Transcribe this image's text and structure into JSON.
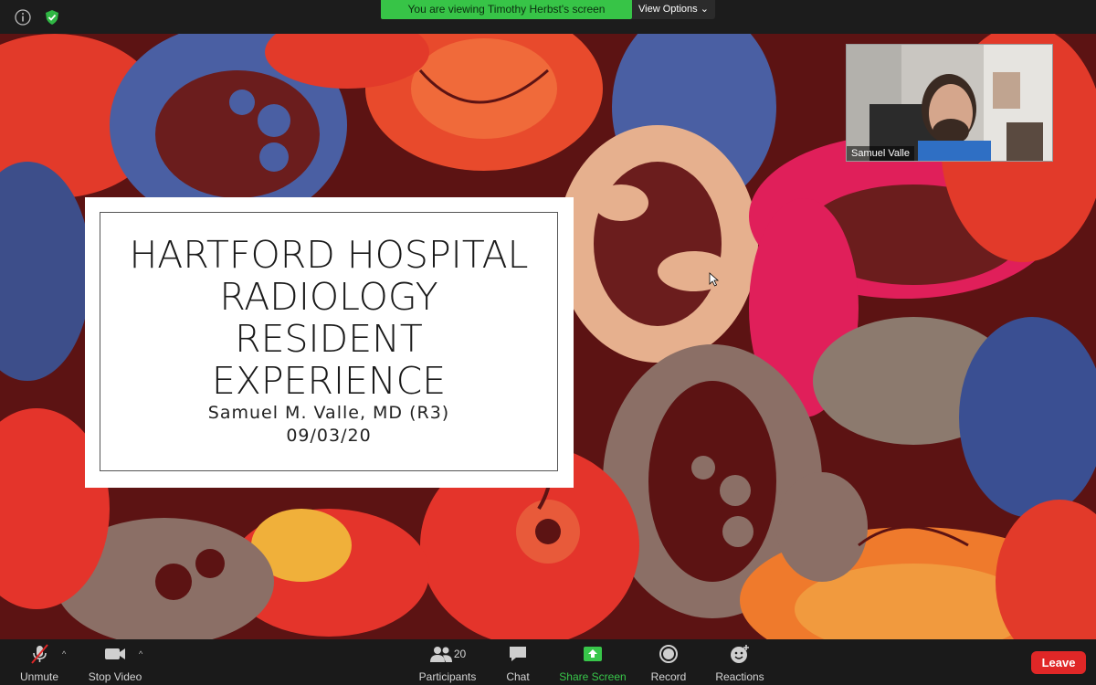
{
  "banner": {
    "text": "You are viewing Timothy Herbst's screen",
    "view_options": "View Options"
  },
  "slide": {
    "title_lines": [
      "HARTFORD HOSPITAL",
      "RADIOLOGY",
      "RESIDENT",
      "EXPERIENCE"
    ],
    "presenter": "Samuel M. Valle, MD (R3)",
    "date": "09/03/20"
  },
  "video": {
    "name": "Samuel Valle"
  },
  "toolbar": {
    "unmute": "Unmute",
    "stop_video": "Stop Video",
    "participants": "Participants",
    "participants_count": "20",
    "chat": "Chat",
    "share_screen": "Share Screen",
    "record": "Record",
    "reactions": "Reactions",
    "leave": "Leave"
  },
  "colors": {
    "banner_green": "#37c447",
    "leave_red": "#e02727",
    "share_green": "#38c64a"
  }
}
